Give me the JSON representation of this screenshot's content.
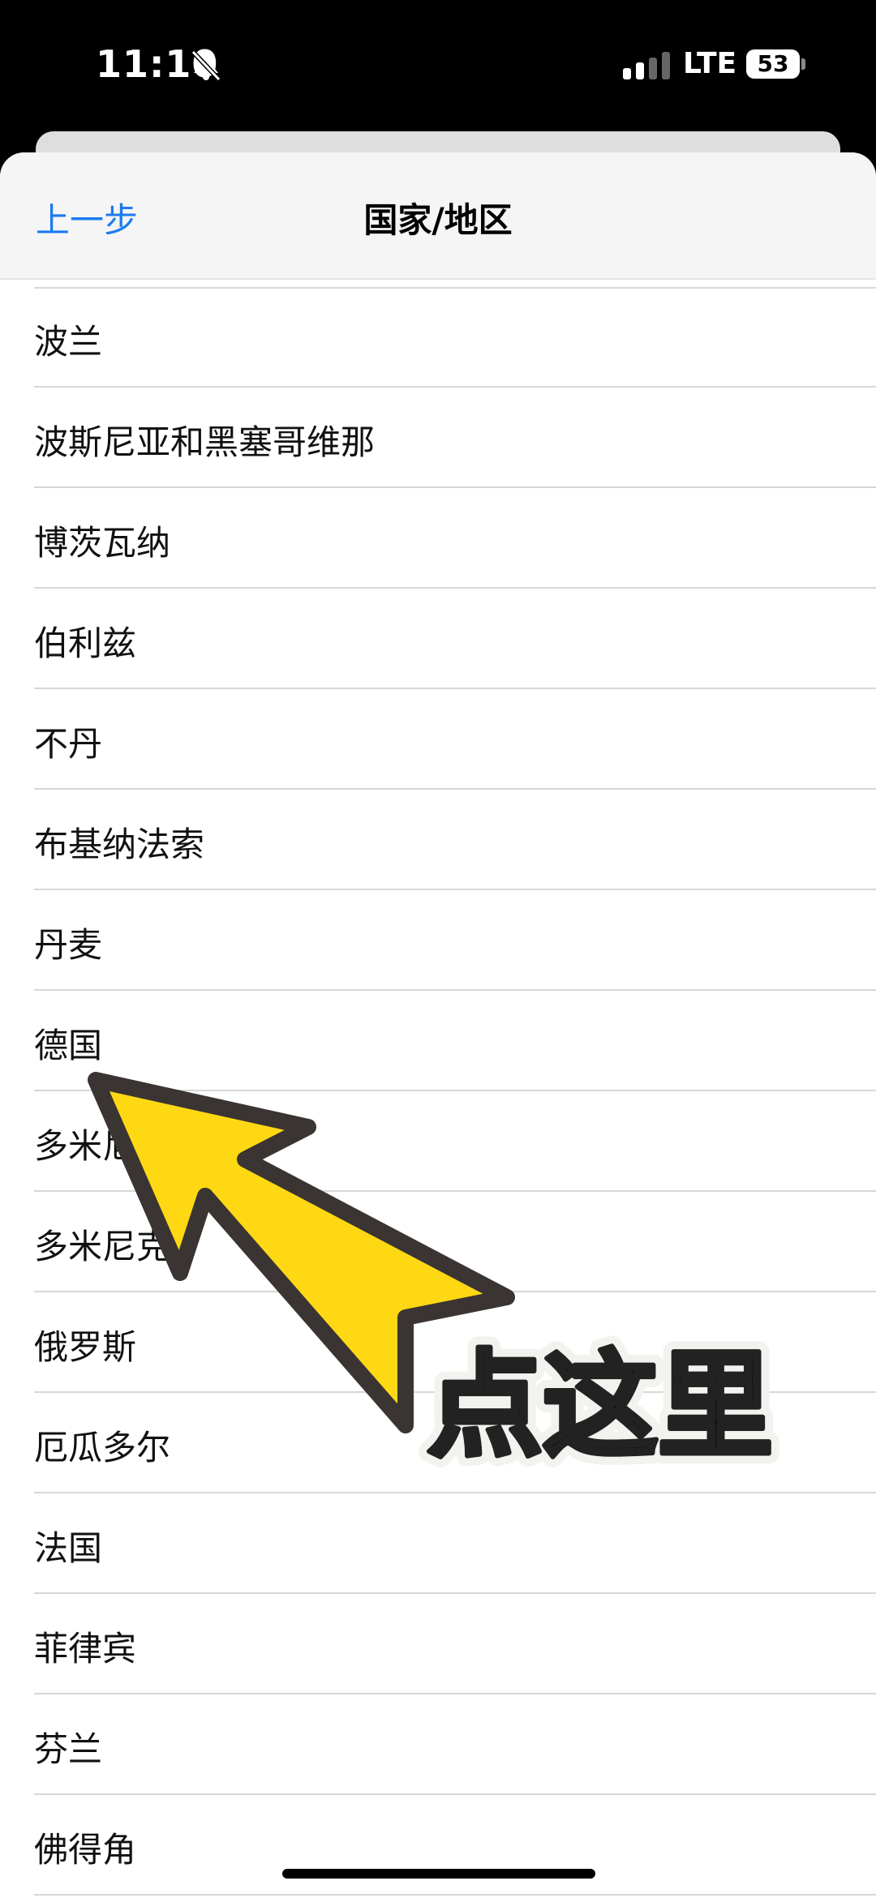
{
  "status_bar": {
    "time": "11:10",
    "network": "LTE",
    "battery": "53"
  },
  "nav": {
    "back_label": "上一步",
    "title": "国家/地区",
    "accent_color": "#1a7bf2"
  },
  "countries": [
    "波兰",
    "波斯尼亚和黑塞哥维那",
    "博茨瓦纳",
    "伯利兹",
    "不丹",
    "布基纳法索",
    "丹麦",
    "德国",
    "多米尼加",
    "多米尼克",
    "俄罗斯",
    "厄瓜多尔",
    "法国",
    "菲律宾",
    "芬兰",
    "佛得角"
  ],
  "overlay": {
    "annotation_text": "点这里",
    "arrow_color": "#ffd814"
  }
}
